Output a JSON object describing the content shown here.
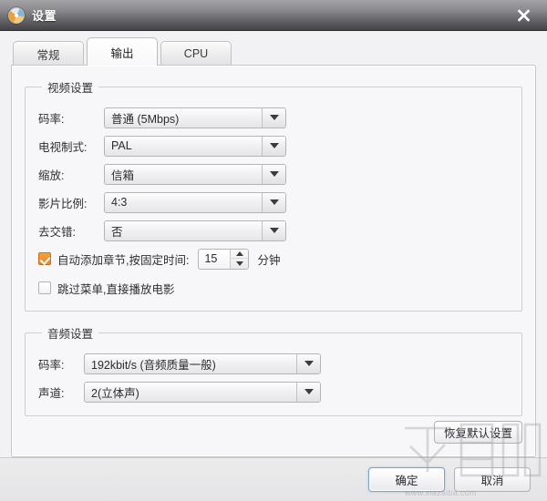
{
  "window": {
    "title": "设置",
    "icon": "disc-icon",
    "close_label": "✕"
  },
  "tabs": [
    {
      "label": "常规",
      "active": false
    },
    {
      "label": "输出",
      "active": true
    },
    {
      "label": "CPU",
      "active": false
    }
  ],
  "video_group": {
    "legend": "视频设置",
    "fields": [
      {
        "label": "码率:",
        "value": "普通 (5Mbps)"
      },
      {
        "label": "电视制式:",
        "value": "PAL"
      },
      {
        "label": "缩放:",
        "value": "信箱"
      },
      {
        "label": "影片比例:",
        "value": "4:3"
      },
      {
        "label": "去交错:",
        "value": "否"
      }
    ],
    "chapter_checkbox": {
      "label": "自动添加章节,按固定时间:",
      "checked": true,
      "value": "15",
      "unit": "分钟"
    },
    "skip_menu_checkbox": {
      "label": "跳过菜单,直接播放电影",
      "checked": false
    }
  },
  "audio_group": {
    "legend": "音频设置",
    "fields": [
      {
        "label": "码率:",
        "value": "192kbit/s (音频质量一般)"
      },
      {
        "label": "声道:",
        "value": "2(立体声)"
      }
    ]
  },
  "buttons": {
    "restore_defaults": "恢复默认设置",
    "ok": "确定",
    "cancel": "取消"
  },
  "watermark": {
    "logo": "下载吧",
    "url": "www.xiazaiba.com"
  },
  "colors": {
    "accent_orange": "#e9852a",
    "default_button_border": "#7ba3cd",
    "titlebar_dark": "#444448"
  }
}
